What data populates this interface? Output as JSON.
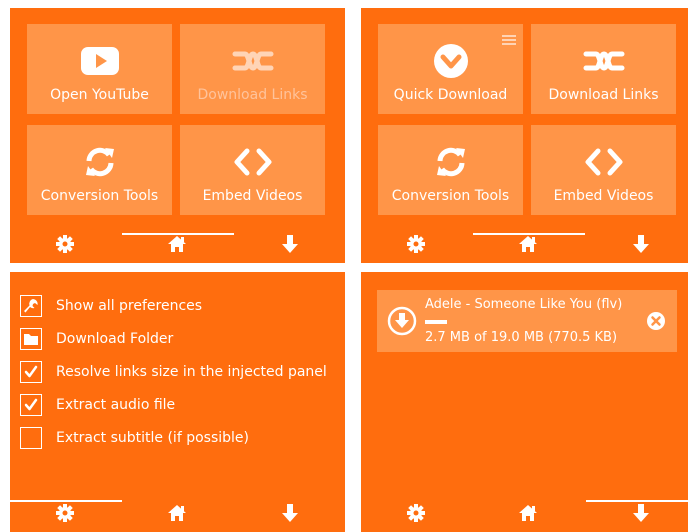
{
  "colors": {
    "panel": "#ff6d0e",
    "tile": "#ff9548",
    "text": "#ffffff",
    "disabled_text": "#ffc39b"
  },
  "panel1": {
    "tiles": [
      {
        "label": "Open YouTube",
        "icon": "youtube-icon"
      },
      {
        "label": "Download Links",
        "icon": "download-links-icon",
        "disabled": true
      },
      {
        "label": "Conversion Tools",
        "icon": "refresh-icon"
      },
      {
        "label": "Embed Videos",
        "icon": "code-icon"
      }
    ]
  },
  "panel2": {
    "tiles": [
      {
        "label": "Quick Download",
        "icon": "chevron-down-circle-icon",
        "menu_icon": "hamburger-menu-icon"
      },
      {
        "label": "Download Links",
        "icon": "download-links-icon"
      },
      {
        "label": "Conversion Tools",
        "icon": "refresh-icon"
      },
      {
        "label": "Embed Videos",
        "icon": "code-icon"
      }
    ]
  },
  "nav": {
    "items": [
      "gear-icon",
      "home-icon",
      "download-arrow-icon"
    ]
  },
  "preferences": {
    "items": [
      {
        "label": "Show all preferences",
        "icon": "wrench-icon"
      },
      {
        "label": "Download Folder",
        "icon": "folder-icon"
      },
      {
        "label": "Resolve links size in the injected panel",
        "checked": true
      },
      {
        "label": "Extract audio file",
        "checked": true
      },
      {
        "label": "Extract subtitle (if possible)",
        "checked": false
      }
    ]
  },
  "download": {
    "title": "Adele - Someone Like You (flv)",
    "size_text": "2.7 MB of 19.0 MB (770.5 KB)",
    "progress": 0.14,
    "icons": [
      "download-circle-icon",
      "close-icon"
    ]
  }
}
